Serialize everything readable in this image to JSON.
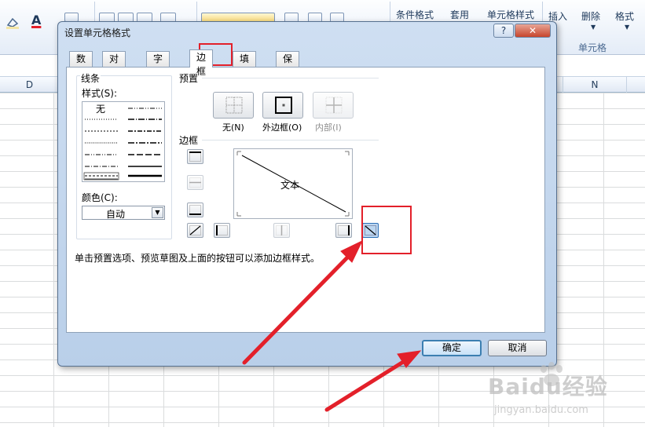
{
  "ribbon": {
    "font_color_letter": "A",
    "items": {
      "conditional_format": "条件格式",
      "apply_table": "套用",
      "cell_styles": "单元格样式",
      "insert": "插入",
      "delete": "删除",
      "format": "格式"
    },
    "group_label": "单元格"
  },
  "columns": {
    "left": "D",
    "right": "N"
  },
  "dialog": {
    "title": "设置单元格格式",
    "help_label": "?",
    "close_label": "✕",
    "tabs": [
      "数字",
      "对齐",
      "字体",
      "边框",
      "填充",
      "保护"
    ],
    "active_tab": "边框",
    "line": {
      "section_label": "线条",
      "style_label": "样式(S):",
      "none_label": "无",
      "color_label": "颜色(C):",
      "color_value": "自动"
    },
    "presets": {
      "section_label": "预置",
      "none": "无(N)",
      "outline": "外边框(O)",
      "inside": "内部(I)"
    },
    "border": {
      "section_label": "边框",
      "preview_text": "文本"
    },
    "hint": "单击预置选项、预览草图及上面的按钮可以添加边框样式。",
    "ok_label": "确定",
    "cancel_label": "取消"
  },
  "watermark": {
    "brand": "Baidu经验",
    "url": "jingyan.baidu.com"
  },
  "colors": {
    "annotation_red": "#e3202a",
    "dialog_frame": "#b9cfe9",
    "selected_button": "#bcd6f0"
  }
}
